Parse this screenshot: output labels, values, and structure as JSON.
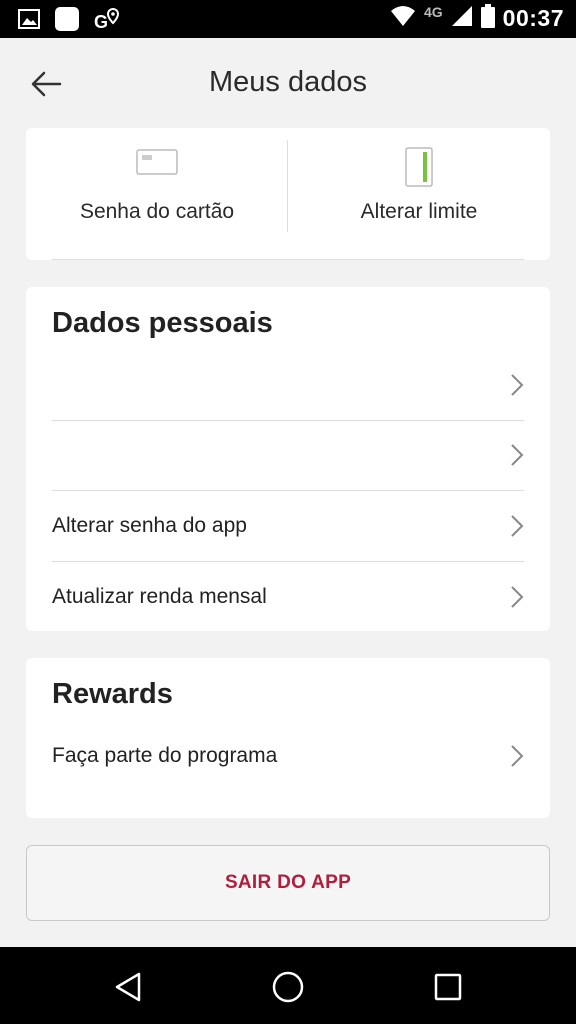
{
  "status_bar": {
    "time": "00:37",
    "network": "4G",
    "icons": [
      "image-icon",
      "notification-square-icon",
      "maps-icon",
      "wifi-icon",
      "signal-icon",
      "battery-icon"
    ]
  },
  "header": {
    "title": "Meus dados",
    "back_icon": "arrow-left-icon"
  },
  "quick_actions": [
    {
      "label": "Senha do cartão",
      "icon": "card-icon"
    },
    {
      "label": "Alterar limite",
      "icon": "limit-bar-icon"
    }
  ],
  "personal": {
    "title": "Dados pessoais",
    "items": [
      {
        "label": ""
      },
      {
        "label": ""
      },
      {
        "label": "Alterar senha do app"
      },
      {
        "label": "Atualizar renda mensal"
      }
    ]
  },
  "rewards": {
    "title": "Rewards",
    "items": [
      {
        "label": "Faça parte do programa"
      }
    ]
  },
  "logout": {
    "label": "SAIR DO APP"
  },
  "colors": {
    "accent": "#b01e3e",
    "limit_bar": "#7ac143",
    "background": "#f2f2f2"
  },
  "nav": [
    "back-triangle-icon",
    "home-circle-icon",
    "recents-square-icon"
  ]
}
